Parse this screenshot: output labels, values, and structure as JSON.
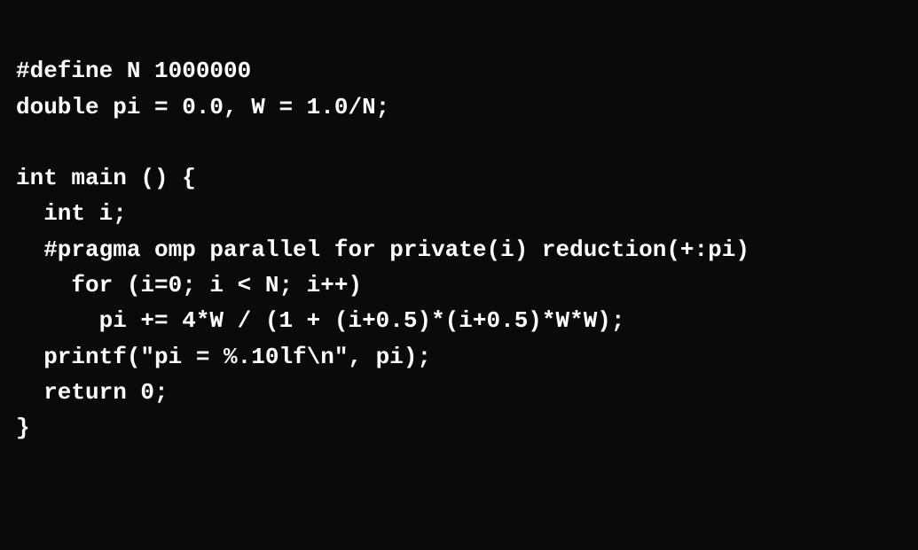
{
  "code": {
    "lines": [
      {
        "id": "line1",
        "text": "#define N 1000000"
      },
      {
        "id": "line2",
        "text": "double pi = 0.0, W = 1.0/N;"
      },
      {
        "id": "line3",
        "text": ""
      },
      {
        "id": "line4",
        "text": "int main () {"
      },
      {
        "id": "line5",
        "text": "  int i;"
      },
      {
        "id": "line6",
        "text": "  #pragma omp parallel for private(i) reduction(+:pi)"
      },
      {
        "id": "line7",
        "text": "    for (i=0; i < N; i++)"
      },
      {
        "id": "line8",
        "text": "      pi += 4*W / (1 + (i+0.5)*(i+0.5)*W*W);"
      },
      {
        "id": "line9",
        "text": "  printf(\"pi = %.10lf\\n\", pi);"
      },
      {
        "id": "line10",
        "text": "  return 0;"
      },
      {
        "id": "line11",
        "text": "}"
      }
    ]
  }
}
